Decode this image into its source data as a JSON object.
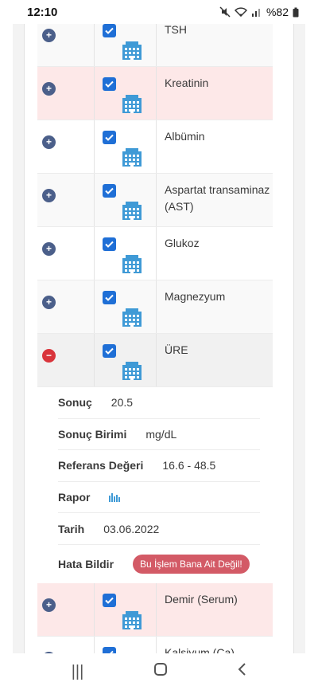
{
  "status_bar": {
    "time": "12:10",
    "battery": "%82"
  },
  "colors": {
    "accent": "#1f6fd6",
    "expand": "#4b5f8a",
    "collapse": "#d9343b",
    "highlight_row": "#fde8e8",
    "report_button": "#d35a66",
    "building_icon": "#3f9ad6"
  },
  "tests": [
    {
      "name": "TSH",
      "state": "collapsed",
      "checked": true
    },
    {
      "name": "Kreatinin",
      "state": "collapsed",
      "checked": true
    },
    {
      "name": "Albümin",
      "state": "collapsed",
      "checked": true
    },
    {
      "name": "Aspartat transaminaz (AST)",
      "state": "collapsed",
      "checked": true
    },
    {
      "name": "Glukoz",
      "state": "collapsed",
      "checked": true
    },
    {
      "name": "Magnezyum",
      "state": "collapsed",
      "checked": true
    },
    {
      "name": "ÜRE",
      "state": "expanded",
      "checked": true
    },
    {
      "name": "Demir (Serum)",
      "state": "collapsed",
      "checked": true
    },
    {
      "name": "Kalsiyum (Ca)",
      "state": "collapsed",
      "checked": true
    }
  ],
  "detail": {
    "result_label": "Sonuç",
    "result_value": "20.5",
    "unit_label": "Sonuç Birimi",
    "unit_value": "mg/dL",
    "reference_label": "Referans Değeri",
    "reference_value": "16.6 - 48.5",
    "report_label": "Rapor",
    "report_icon": "bar-chart-icon",
    "date_label": "Tarih",
    "date_value": "03.06.2022",
    "error_label": "Hata Bildir",
    "error_button": "Bu İşlem Bana Ait Değil!"
  },
  "nav": {
    "recent": "recent-apps-icon",
    "home": "home-icon",
    "back": "back-icon"
  }
}
